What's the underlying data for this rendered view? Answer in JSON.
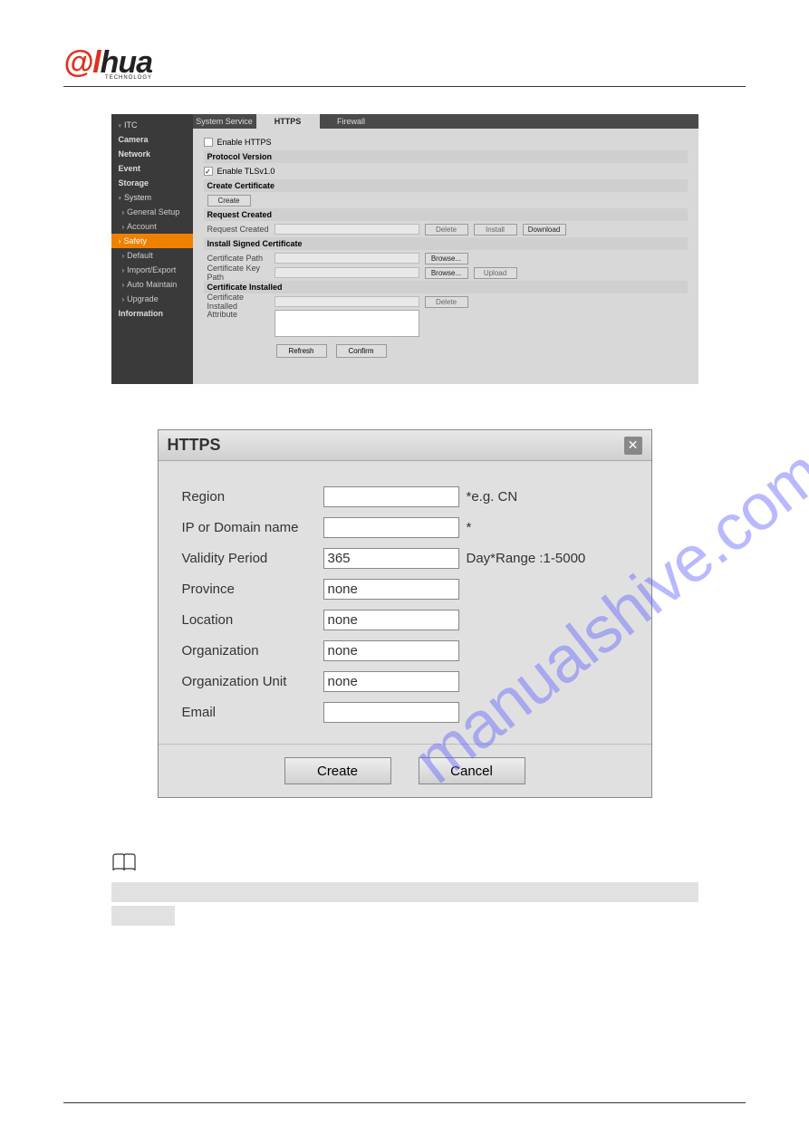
{
  "logo": {
    "brand": "alhua",
    "sub": "TECHNOLOGY"
  },
  "watermark": "manualshive.com",
  "sidebar": {
    "items": [
      {
        "label": "ITC",
        "kind": "expandable"
      },
      {
        "label": "Camera",
        "kind": "main"
      },
      {
        "label": "Network",
        "kind": "main"
      },
      {
        "label": "Event",
        "kind": "main"
      },
      {
        "label": "Storage",
        "kind": "main"
      },
      {
        "label": "System",
        "kind": "expandable"
      },
      {
        "label": "General Setup",
        "kind": "sub"
      },
      {
        "label": "Account",
        "kind": "sub"
      },
      {
        "label": "Safety",
        "kind": "active"
      },
      {
        "label": "Default",
        "kind": "sub"
      },
      {
        "label": "Import/Export",
        "kind": "sub"
      },
      {
        "label": "Auto Maintain",
        "kind": "sub"
      },
      {
        "label": "Upgrade",
        "kind": "sub"
      },
      {
        "label": "Information",
        "kind": "main"
      }
    ]
  },
  "tabs": [
    {
      "label": "System Service",
      "active": false
    },
    {
      "label": "HTTPS",
      "active": true
    },
    {
      "label": "Firewall",
      "active": false
    }
  ],
  "panel": {
    "enable_https_label": "Enable HTTPS",
    "section_protocol": "Protocol Version",
    "enable_tls_label": "Enable TLSv1.0",
    "section_create": "Create Certificate",
    "btn_create": "Create",
    "section_request": "Request Created",
    "label_request_created": "Request Created",
    "btn_delete": "Delete",
    "btn_install": "Install",
    "btn_download": "Download",
    "section_install_signed": "Install Signed Certificate",
    "label_cert_path": "Certificate Path",
    "label_cert_key_path": "Certificate Key Path",
    "btn_browse": "Browse...",
    "btn_upload": "Upload",
    "section_cert_installed": "Certificate Installed",
    "label_cert_installed": "Certificate Installed",
    "label_attribute": "Attribute",
    "btn_refresh": "Refresh",
    "btn_confirm": "Confirm"
  },
  "dialog": {
    "title": "HTTPS",
    "fields": {
      "region": {
        "label": "Region",
        "value": "",
        "hint": "*e.g. CN"
      },
      "ip_domain": {
        "label": "IP or Domain name",
        "value": "",
        "hint": "*"
      },
      "validity": {
        "label": "Validity Period",
        "value": "365",
        "hint": "Day*Range :1-5000"
      },
      "province": {
        "label": "Province",
        "value": "none",
        "hint": ""
      },
      "location": {
        "label": "Location",
        "value": "none",
        "hint": ""
      },
      "organization": {
        "label": "Organization",
        "value": "none",
        "hint": ""
      },
      "org_unit": {
        "label": "Organization Unit",
        "value": "none",
        "hint": ""
      },
      "email": {
        "label": "Email",
        "value": "",
        "hint": ""
      }
    },
    "btn_create": "Create",
    "btn_cancel": "Cancel"
  }
}
